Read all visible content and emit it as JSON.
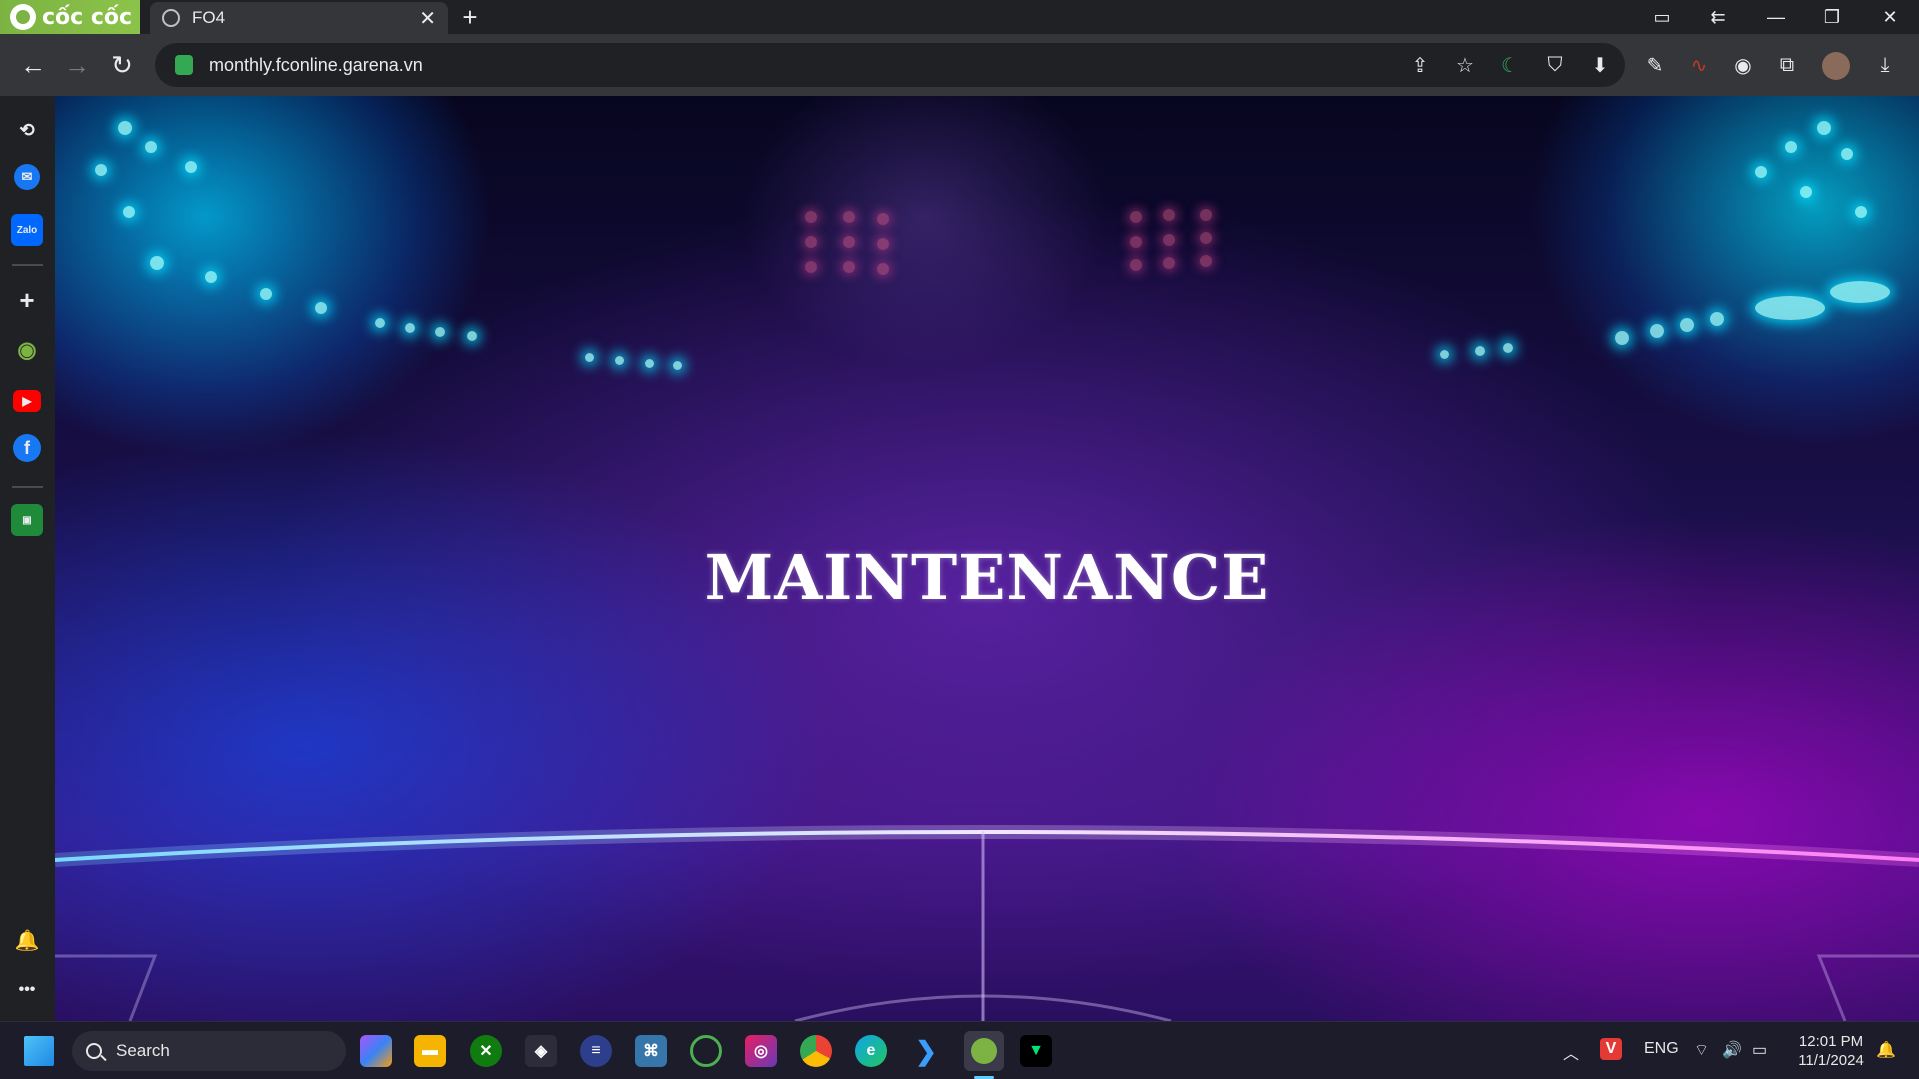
{
  "browser": {
    "brand": "cốc cốc",
    "tab": {
      "title": "FO4",
      "close": "✕"
    },
    "new_tab": "+",
    "url": "monthly.fconline.garena.vn"
  },
  "page": {
    "headline": "MAINTENANCE"
  },
  "sidebar": {
    "items": [
      {
        "name": "history-icon",
        "glyph": "⟲"
      },
      {
        "name": "messenger-icon",
        "glyph": "✉"
      },
      {
        "name": "zalo-icon",
        "glyph": "Zalo"
      },
      {
        "name": "add-icon",
        "glyph": "+"
      },
      {
        "name": "coccoc-icon",
        "glyph": "◉"
      },
      {
        "name": "youtube-icon",
        "glyph": "▶"
      },
      {
        "name": "facebook-icon",
        "glyph": "f"
      },
      {
        "name": "game-icon",
        "glyph": "▣"
      },
      {
        "name": "bell-icon",
        "glyph": "🔔"
      },
      {
        "name": "more-icon",
        "glyph": "•••"
      }
    ]
  },
  "taskbar": {
    "search_label": "Search",
    "language": "ENG",
    "time": "12:01 PM",
    "date": "11/1/2024"
  },
  "colors": {
    "brand": "#7cb342",
    "chrome_dark": "#202124",
    "toolbar": "#35363a",
    "taskbar": "#1c1c2a",
    "text": "#ffffff"
  }
}
